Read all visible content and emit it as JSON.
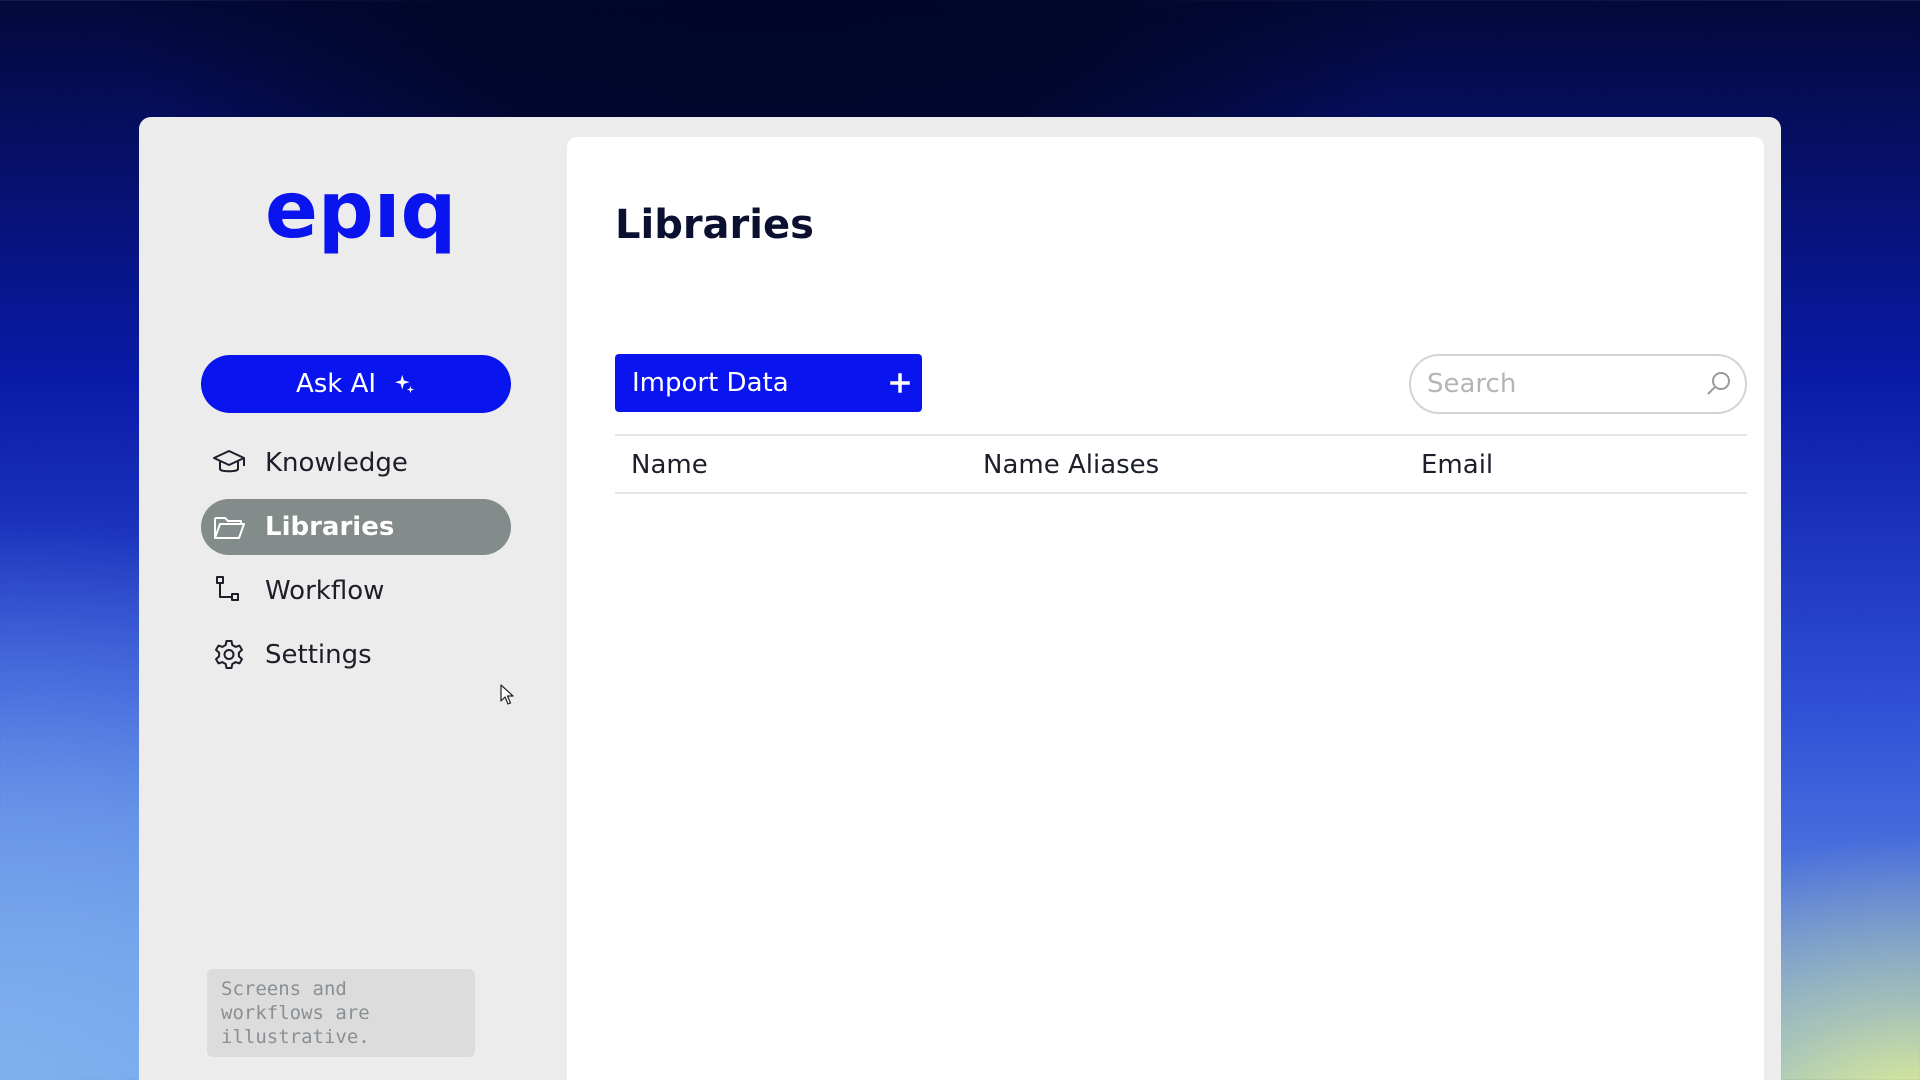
{
  "brand": {
    "logo_text": "epiq",
    "accent_color": "#0a14ef"
  },
  "sidebar": {
    "ask_ai": {
      "label": "Ask AI",
      "icon": "sparkle-icon"
    },
    "items": [
      {
        "label": "Knowledge",
        "icon": "graduation-cap-icon",
        "active": false
      },
      {
        "label": "Libraries",
        "icon": "folder-icon",
        "active": true
      },
      {
        "label": "Workflow",
        "icon": "workflow-icon",
        "active": false
      },
      {
        "label": "Settings",
        "icon": "gear-icon",
        "active": false
      }
    ],
    "note": "Screens and workflows are illustrative."
  },
  "main": {
    "title": "Libraries",
    "import_button": {
      "label": "Import Data",
      "icon": "plus-icon"
    },
    "search": {
      "placeholder": "Search",
      "value": "",
      "icon": "search-icon"
    },
    "table": {
      "columns": [
        "Name",
        "Name Aliases",
        "Email"
      ],
      "rows": []
    }
  }
}
